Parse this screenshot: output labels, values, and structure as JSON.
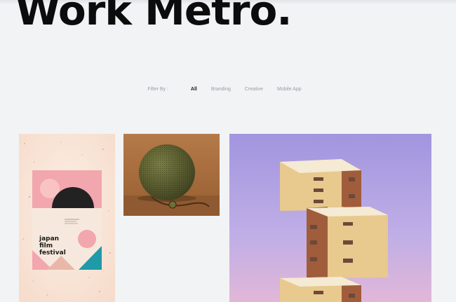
{
  "header": {
    "title": "Work Metro."
  },
  "filters": {
    "label": "Filter By :",
    "items": [
      {
        "label": "All",
        "active": true
      },
      {
        "label": "Branding",
        "active": false
      },
      {
        "label": "Creative",
        "active": false
      },
      {
        "label": "Mobile App",
        "active": false
      }
    ]
  },
  "portfolio": {
    "items": [
      {
        "image": "japan-film-festival-poster",
        "poster_text": [
          "japan",
          "film",
          "festival"
        ]
      },
      {
        "image": "olive-round-speaker"
      },
      {
        "image": "stacked-building-purple-sky"
      }
    ]
  },
  "colors": {
    "background": "#f2f3f5",
    "title": "#0c0c0c",
    "filter_inactive": "#9a9ca2",
    "filter_active": "#1b1b1b",
    "poster_pink": "#f1a4ad",
    "poster_teal": "#1f9aa8",
    "speaker_olive": "#565a2e",
    "sky_purple": "#a79ae0",
    "building_tan": "#e8c98e"
  }
}
